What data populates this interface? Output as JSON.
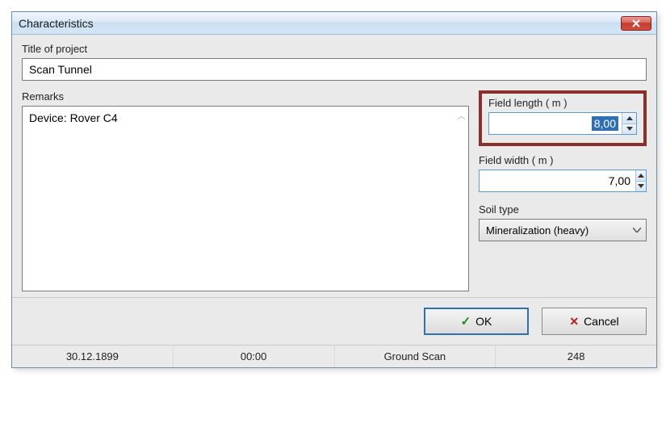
{
  "dialog": {
    "title": "Characteristics"
  },
  "project": {
    "title_label": "Title of project",
    "title_value": "Scan Tunnel"
  },
  "remarks": {
    "label": "Remarks",
    "value": "Device: Rover C4"
  },
  "field_length": {
    "label": "Field length ( m )",
    "value": "8,00"
  },
  "field_width": {
    "label": "Field width ( m )",
    "value": "7,00"
  },
  "soil": {
    "label": "Soil type",
    "value": "Mineralization (heavy)"
  },
  "buttons": {
    "ok": "OK",
    "cancel": "Cancel"
  },
  "status": {
    "date": "30.12.1899",
    "time": "00:00",
    "mode": "Ground Scan",
    "count": "248"
  }
}
